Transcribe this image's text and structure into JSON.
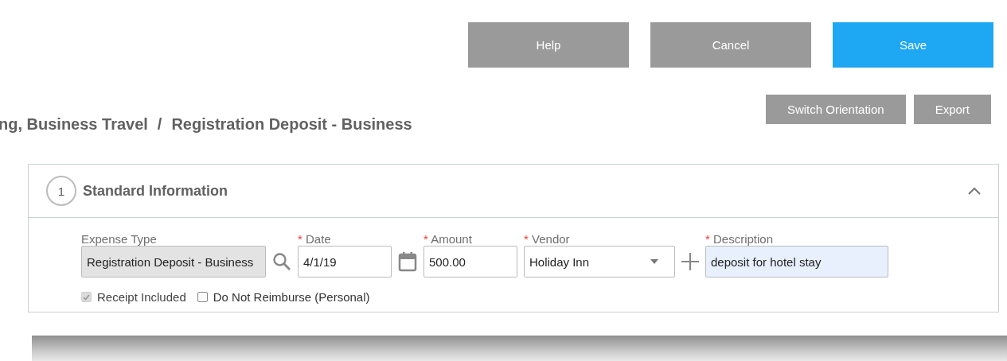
{
  "actions": [
    {
      "label": "Help",
      "primary": false
    },
    {
      "label": "Cancel",
      "primary": false
    },
    {
      "label": "Save",
      "primary": true
    }
  ],
  "tools": [
    "Switch Orientation",
    "Export"
  ],
  "breadcrumb": {
    "parts": [
      "ng, Business Travel",
      "Registration Deposit - Business"
    ],
    "separator": "/"
  },
  "section": {
    "number": "1",
    "title": "Standard Information",
    "expanded": true,
    "fields": [
      {
        "label": "Expense Type",
        "required": false,
        "kind": "readonly",
        "value": "Registration Deposit - Business",
        "autofilled": false
      },
      {
        "label": "Date",
        "required": true,
        "marker": "*",
        "kind": "date",
        "value": "4/1/19",
        "autofilled": false
      },
      {
        "label": "Amount",
        "required": true,
        "marker": "*",
        "kind": "text",
        "value": "500.00",
        "autofilled": false
      },
      {
        "label": "Vendor",
        "required": true,
        "marker": "*",
        "kind": "select",
        "value": "Holiday Inn",
        "autofilled": false
      },
      {
        "label": "Description",
        "required": true,
        "marker": "*",
        "kind": "wide",
        "value": "deposit for hotel stay",
        "autofilled": true
      }
    ],
    "checkboxes": [
      {
        "label": "Receipt Included",
        "checked": true,
        "disabled": true
      },
      {
        "label": "Do Not Reimburse (Personal)",
        "checked": false,
        "disabled": false
      }
    ]
  }
}
